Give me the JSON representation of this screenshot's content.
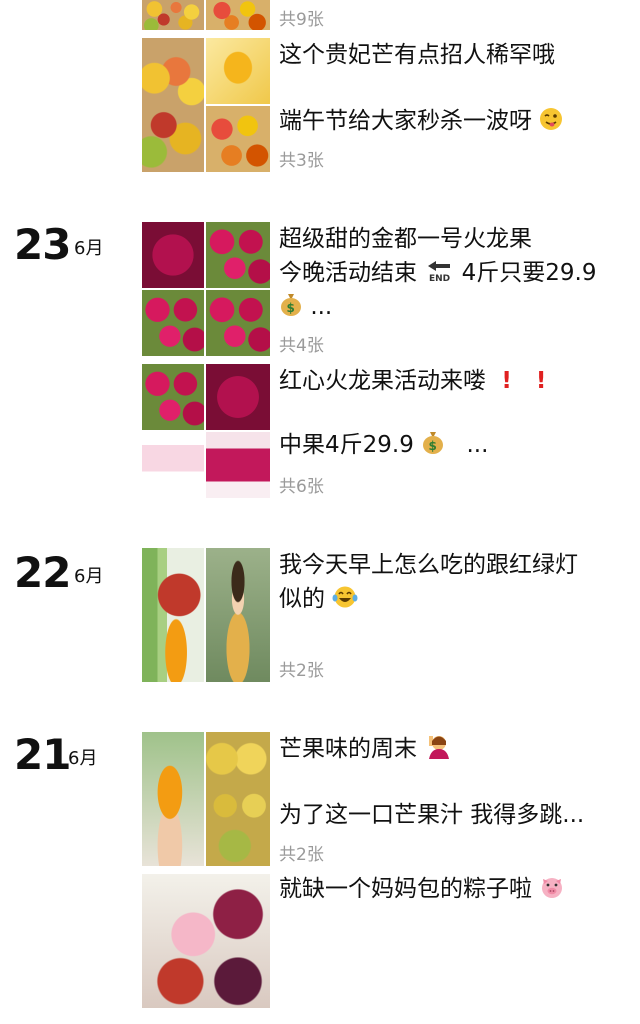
{
  "posts": [
    {
      "date_day": "",
      "date_month": "",
      "entries": [
        {
          "lines": [],
          "count": "共9张"
        },
        {
          "lines": [
            "这个贵妃芒有点招人稀罕哦",
            "端午节给大家秒杀一波呀"
          ],
          "count": "共3张"
        }
      ]
    },
    {
      "date_day": "23",
      "date_month": "6月",
      "entries": [
        {
          "lines": [
            "超级甜的金都一号火龙果",
            "今晚活动结束",
            "4斤只要29.9",
            "..."
          ],
          "count": "共4张"
        },
        {
          "lines": [
            "红心火龙果活动来喽",
            "中果4斤29.9",
            "..."
          ],
          "count": "共6张"
        }
      ]
    },
    {
      "date_day": "22",
      "date_month": "6月",
      "entries": [
        {
          "lines": [
            "我今天早上怎么吃的跟红绿灯",
            "似的"
          ],
          "count": "共2张"
        }
      ]
    },
    {
      "date_day": "21",
      "date_month": "6月",
      "entries": [
        {
          "lines": [
            "芒果味的周末",
            "为了这一口芒果汁 我得多跳..."
          ],
          "count": "共2张"
        },
        {
          "lines": [
            "就缺一个妈妈包的粽子啦"
          ],
          "count": ""
        }
      ]
    }
  ],
  "icons": {
    "wink": "winking-face-tongue",
    "end": "end-arrow",
    "money": "money-bag",
    "exclaim": "red-exclamation",
    "laugh": "tears-of-joy-face",
    "raise": "person-raising-hand",
    "pig": "pig-face"
  },
  "colors": {
    "text": "#111111",
    "muted": "#9a9a9a",
    "exclaim": "#e02020"
  }
}
